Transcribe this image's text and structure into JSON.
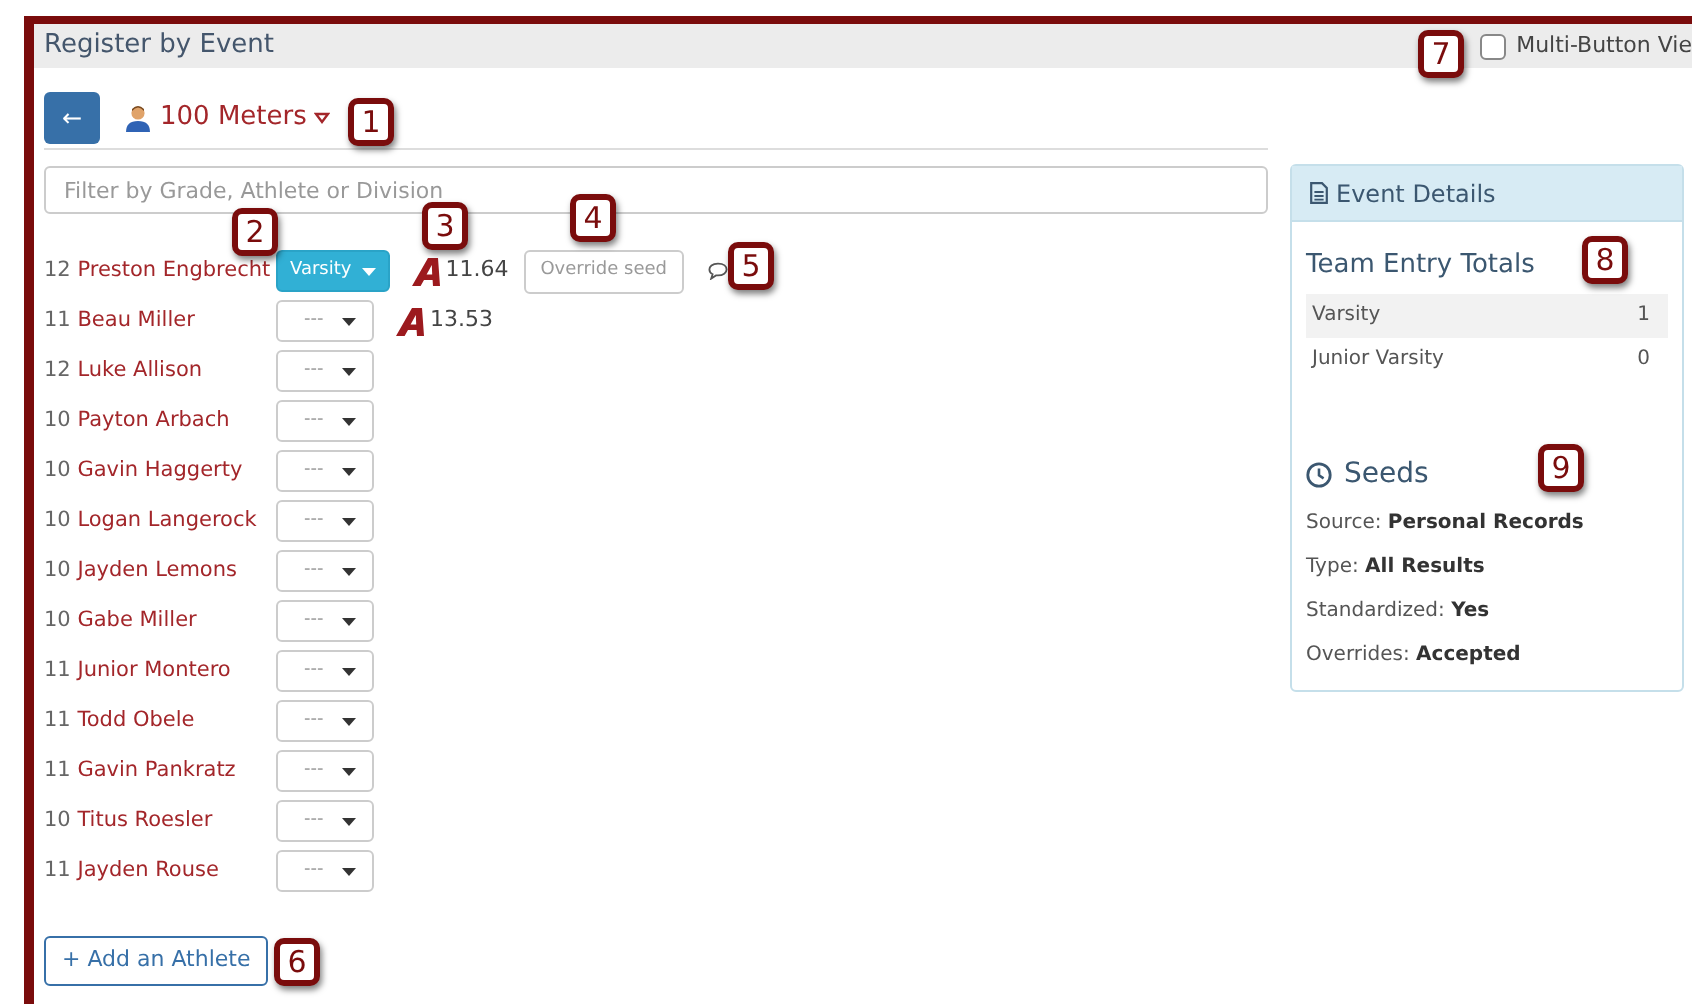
{
  "header": {
    "title": "Register by Event",
    "multi_button_view": {
      "label": "Multi-Button Vie",
      "checked": false
    }
  },
  "event": {
    "back_label": "←",
    "title": "100 Meters"
  },
  "filter": {
    "placeholder": "Filter by Grade, Athlete or Division"
  },
  "athletes": [
    {
      "grade": "12",
      "name": "Preston Engbrecht",
      "division": "Varsity",
      "assigned": true,
      "seed": "11.64",
      "override_label": "Override seed",
      "comment": true
    },
    {
      "grade": "11",
      "name": "Beau Miller",
      "division": "---",
      "assigned": false,
      "seed": "13.53"
    },
    {
      "grade": "12",
      "name": "Luke Allison",
      "division": "---",
      "assigned": false
    },
    {
      "grade": "10",
      "name": "Payton Arbach",
      "division": "---",
      "assigned": false
    },
    {
      "grade": "10",
      "name": "Gavin Haggerty",
      "division": "---",
      "assigned": false
    },
    {
      "grade": "10",
      "name": "Logan Langerock",
      "division": "---",
      "assigned": false
    },
    {
      "grade": "10",
      "name": "Jayden Lemons",
      "division": "---",
      "assigned": false
    },
    {
      "grade": "10",
      "name": "Gabe Miller",
      "division": "---",
      "assigned": false
    },
    {
      "grade": "11",
      "name": "Junior Montero",
      "division": "---",
      "assigned": false
    },
    {
      "grade": "11",
      "name": "Todd Obele",
      "division": "---",
      "assigned": false
    },
    {
      "grade": "11",
      "name": "Gavin Pankratz",
      "division": "---",
      "assigned": false
    },
    {
      "grade": "10",
      "name": "Titus Roesler",
      "division": "---",
      "assigned": false
    },
    {
      "grade": "11",
      "name": "Jayden Rouse",
      "division": "---",
      "assigned": false
    }
  ],
  "add_button": "+ Add an Athlete",
  "event_details": {
    "title": "Event Details",
    "totals_title": "Team Entry Totals",
    "totals": [
      {
        "division": "Varsity",
        "count": "1"
      },
      {
        "division": "Junior Varsity",
        "count": "0"
      }
    ],
    "seeds_title": "Seeds",
    "seeds": [
      "Source: **Personal Records**",
      "Type: **All Results**",
      "Standardized: **Yes**",
      "Overrides: **Accepted**"
    ]
  },
  "callouts": [
    "1",
    "2",
    "3",
    "4",
    "5",
    "6",
    "7",
    "8",
    "9"
  ]
}
